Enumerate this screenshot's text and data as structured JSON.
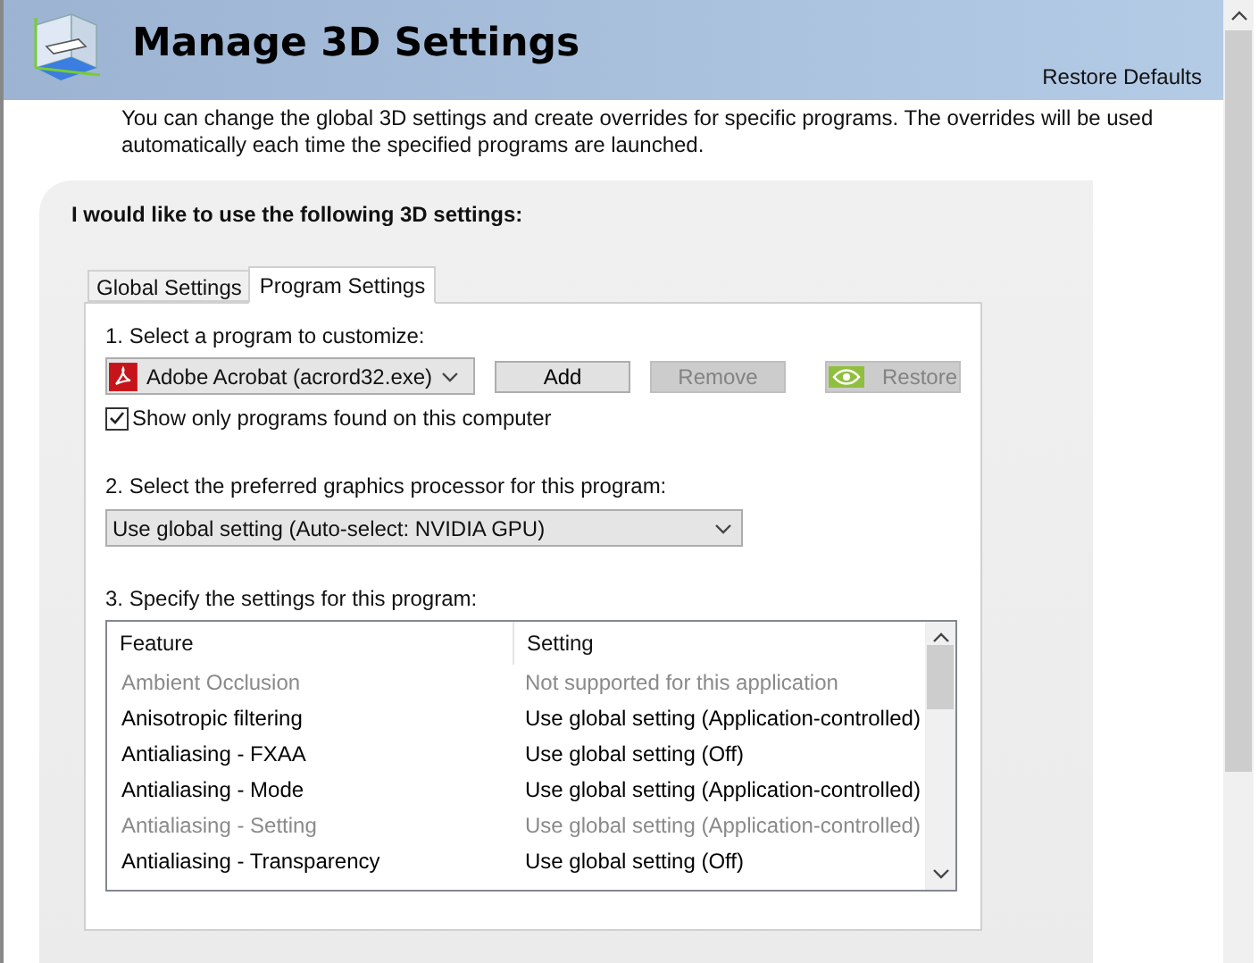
{
  "header": {
    "title": "Manage 3D Settings",
    "restore_link": "Restore Defaults"
  },
  "description": "You can change the global 3D settings and create overrides for specific programs. The overrides will be used automatically each time the specified programs are launched.",
  "panel": {
    "heading": "I would like to use the following 3D settings:",
    "tabs": [
      {
        "label": "Global Settings",
        "selected": false
      },
      {
        "label": "Program Settings",
        "selected": true
      }
    ],
    "program": {
      "label": "1. Select a program to customize:",
      "value": "Adobe Acrobat (acrord32.exe)",
      "buttons": [
        {
          "label": "Add",
          "disabled": false,
          "kind": "plain"
        },
        {
          "label": "Remove",
          "disabled": true,
          "kind": "plain"
        },
        {
          "label": "Restore",
          "disabled": true,
          "kind": "logo"
        }
      ],
      "show_only_found": {
        "label": "Show only programs found on this computer",
        "checked": true
      }
    },
    "processor": {
      "label": "2. Select the preferred graphics processor for this program:",
      "value": "Use global setting (Auto-select: NVIDIA GPU)"
    },
    "settings": {
      "label": "3. Specify the settings for this program:",
      "columns": [
        "Feature",
        "Setting"
      ],
      "rows": [
        {
          "feature": "Ambient Occlusion",
          "setting": "Not supported for this application",
          "disabled": true
        },
        {
          "feature": "Anisotropic filtering",
          "setting": "Use global setting (Application-controlled)",
          "disabled": false
        },
        {
          "feature": "Antialiasing - FXAA",
          "setting": "Use global setting (Off)",
          "disabled": false
        },
        {
          "feature": "Antialiasing - Mode",
          "setting": "Use global setting (Application-controlled)",
          "disabled": false
        },
        {
          "feature": "Antialiasing - Setting",
          "setting": "Use global setting (Application-controlled)",
          "disabled": true
        },
        {
          "feature": "Antialiasing - Transparency",
          "setting": "Use global setting (Off)",
          "disabled": false
        }
      ]
    }
  }
}
